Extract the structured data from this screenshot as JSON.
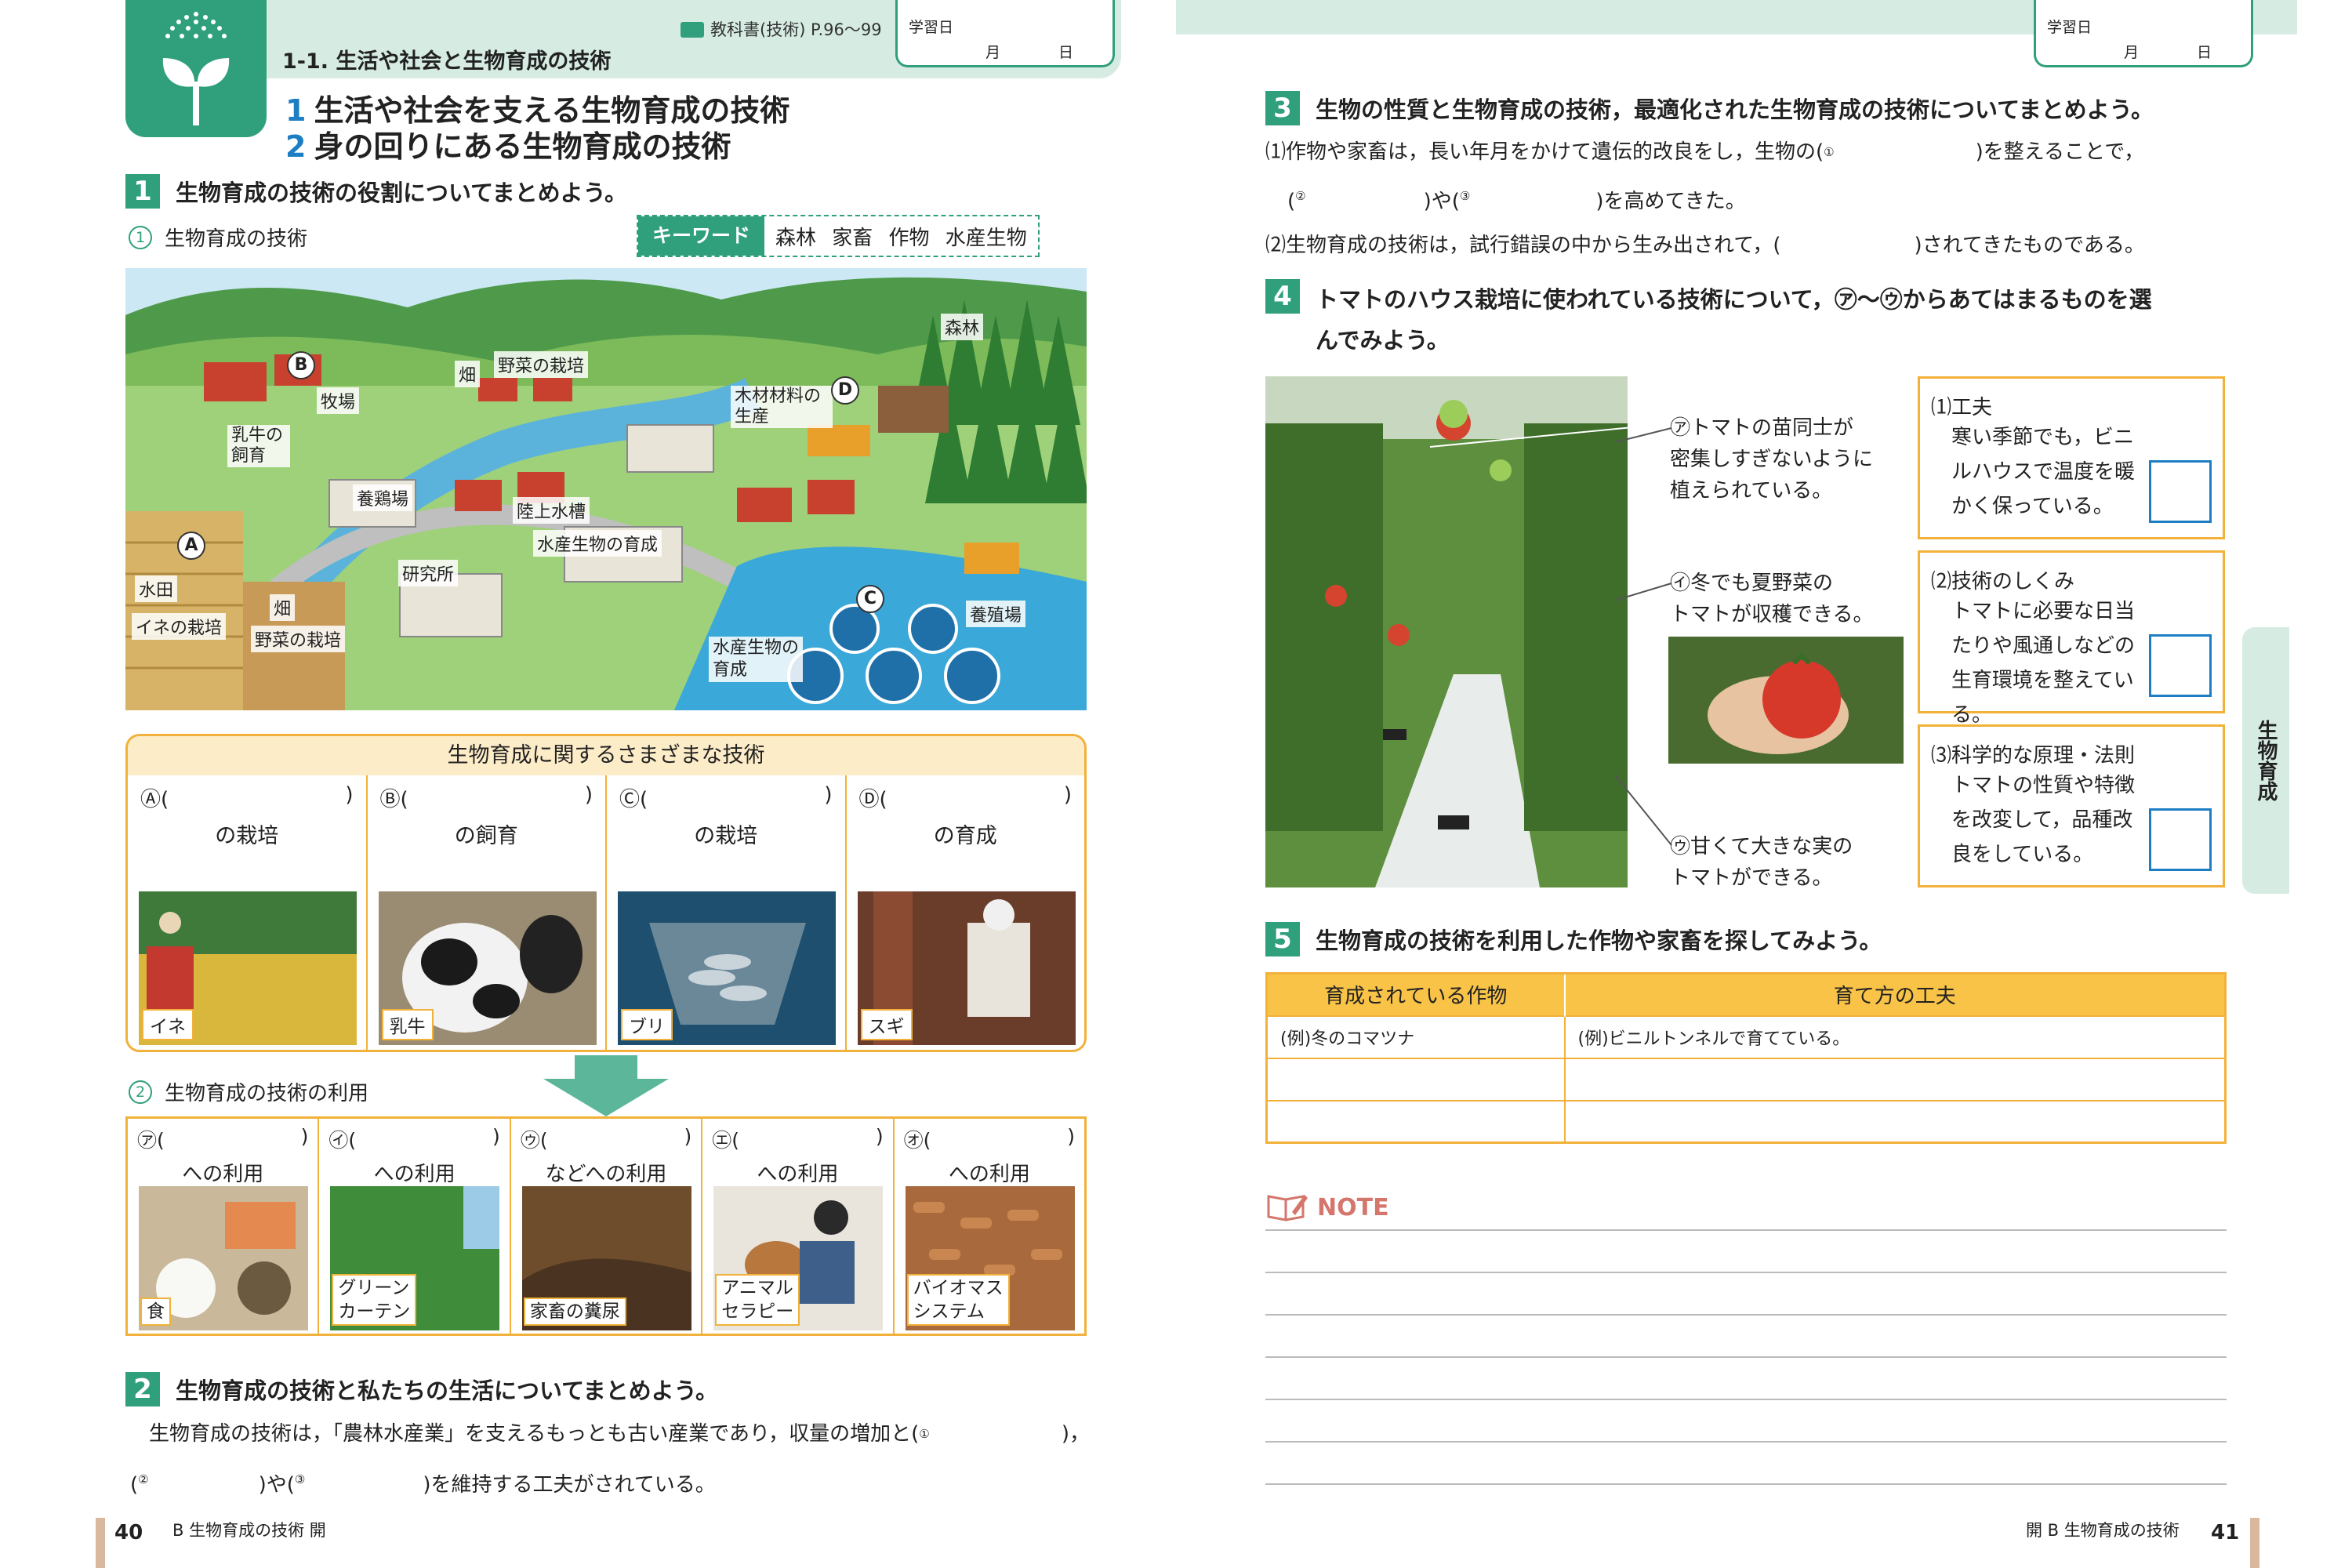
{
  "header": {
    "unit_number": "1-1. 生活や社会と生物育成の技術",
    "textbook_ref": "教科書(技術) P.96〜99",
    "date_label_left": "学習日",
    "date_md_left": "月 日",
    "date_label_right": "学習日",
    "date_md_right": "月 日"
  },
  "titles": {
    "t1_num": "1",
    "t1": "生活や社会を支える生物育成の技術",
    "t2_num": "2",
    "t2": "身の回りにある生物育成の技術"
  },
  "q1": {
    "num": "1",
    "text": "生物育成の技術の役割についてまとめよう。",
    "sub1_num": "1",
    "sub1": "生物育成の技術",
    "keyword_label": "キーワード",
    "keywords": "森林 家畜 作物 水産生物",
    "map_labels": {
      "forest": "森林",
      "veg_field_top": "野菜の栽培",
      "field_top": "畑",
      "ranch": "牧場",
      "dairy": "乳牛の飼育",
      "timber": "木材材料の生産",
      "poultry": "養鶏場",
      "land_tank": "陸上水槽",
      "aquatic_raise": "水産生物の育成",
      "lab": "研究所",
      "paddy": "水田",
      "rice": "イネの栽培",
      "field_bottom": "畑",
      "veg_field_bottom": "野菜の栽培",
      "aquaculture": "養殖場",
      "aquatic_growth": "水産生物の育成"
    },
    "circle_letters": [
      "A",
      "B",
      "C",
      "D"
    ],
    "tech_box_title": "生物育成に関するさまざまな技術",
    "tech_items": [
      {
        "letter": "Ⓐ(",
        "close": ")",
        "suffix": "の栽培",
        "tag": "イネ"
      },
      {
        "letter": "Ⓑ(",
        "close": ")",
        "suffix": "の飼育",
        "tag": "乳牛"
      },
      {
        "letter": "Ⓒ(",
        "close": ")",
        "suffix": "の栽培",
        "tag": "ブリ"
      },
      {
        "letter": "Ⓓ(",
        "close": ")",
        "suffix": "の育成",
        "tag": "スギ"
      }
    ],
    "sub2_num": "2",
    "sub2": "生物育成の技術の利用",
    "use_items": [
      {
        "letter": "㋐(",
        "close": ")",
        "suffix": "への利用",
        "tag": "食"
      },
      {
        "letter": "㋑(",
        "close": ")",
        "suffix": "への利用",
        "tag": "グリーン\nカーテン"
      },
      {
        "letter": "㋒(",
        "close": ")",
        "suffix": "などへの利用",
        "tag": "家畜の糞尿"
      },
      {
        "letter": "㋓(",
        "close": ")",
        "suffix": "への利用",
        "tag": "アニマル\nセラピー"
      },
      {
        "letter": "㋔(",
        "close": ")",
        "suffix": "への利用",
        "tag": "バイオマス\nシステム"
      }
    ]
  },
  "q2": {
    "num": "2",
    "text": "生物育成の技術と私たちの生活についてまとめよう。",
    "line1a": "生物育成の技術は，「農林水産業」を支えるもっとも古い産業であり，収量の増加と(",
    "sup1": "①",
    "line1b": ")，",
    "line2a": "(",
    "sup2": "②",
    "line2b": ")や(",
    "sup3": "③",
    "line2c": ")を維持する工夫がされている。"
  },
  "footer_left": {
    "page": "40",
    "text": "B 生物育成の技術 開"
  },
  "footer_right": {
    "page": "41",
    "text": "開 B 生物育成の技術"
  },
  "q3": {
    "num": "3",
    "text": "生物の性質と生物育成の技術，最適化された生物育成の技術についてまとめよう。",
    "line1a": "⑴作物や家畜は，長い年月をかけて遺伝的改良をし，生物の(",
    "sup1": "①",
    "line1b": ")を整えることで，",
    "line2a": "(",
    "sup2": "②",
    "line2b": ")や(",
    "sup3": "③",
    "line2c": ")を高めてきた。",
    "line3a": "⑵生物育成の技術は，試行錯誤の中から生み出されて，(",
    "line3b": ")されてきたものである。"
  },
  "q4": {
    "num": "4",
    "text_line1": "トマトのハウス栽培に使われている技術について，㋐〜㋒からあてはまるものを選",
    "text_line2": "んでみよう。",
    "notes": [
      {
        "mark": "㋐",
        "text": "トマトの苗同士が\n密集しすぎないように\n植えられている。"
      },
      {
        "mark": "㋑",
        "text": "冬でも夏野菜の\nトマトが収穫できる。"
      },
      {
        "mark": "㋒",
        "text": "甘くて大きな実の\nトマトができる。"
      }
    ],
    "options": [
      {
        "title": "⑴工夫",
        "body": "寒い季節でも，ビニルハウスで温度を暖かく保っている。"
      },
      {
        "title": "⑵技術のしくみ",
        "body": "トマトに必要な日当たりや風通しなどの生育環境を整えている。"
      },
      {
        "title": "⑶科学的な原理・法則",
        "body": "トマトの性質や特徴を改変して，品種改良をしている。"
      }
    ]
  },
  "side_tab": "生物育成",
  "q5": {
    "num": "5",
    "text": "生物育成の技術を利用した作物や家畜を探してみよう。",
    "col1": "育成されている作物",
    "col2": "育て方の工夫",
    "rows": [
      [
        "(例)冬のコマツナ",
        "(例)ビニルトンネルで育てている。"
      ],
      [
        "",
        ""
      ],
      [
        "",
        ""
      ]
    ]
  },
  "note": {
    "title": "NOTE"
  },
  "colors": {
    "green": "#2f9f7c",
    "orange": "#f2b13a",
    "blue": "#1e7ec4",
    "band": "#d6ece3"
  }
}
